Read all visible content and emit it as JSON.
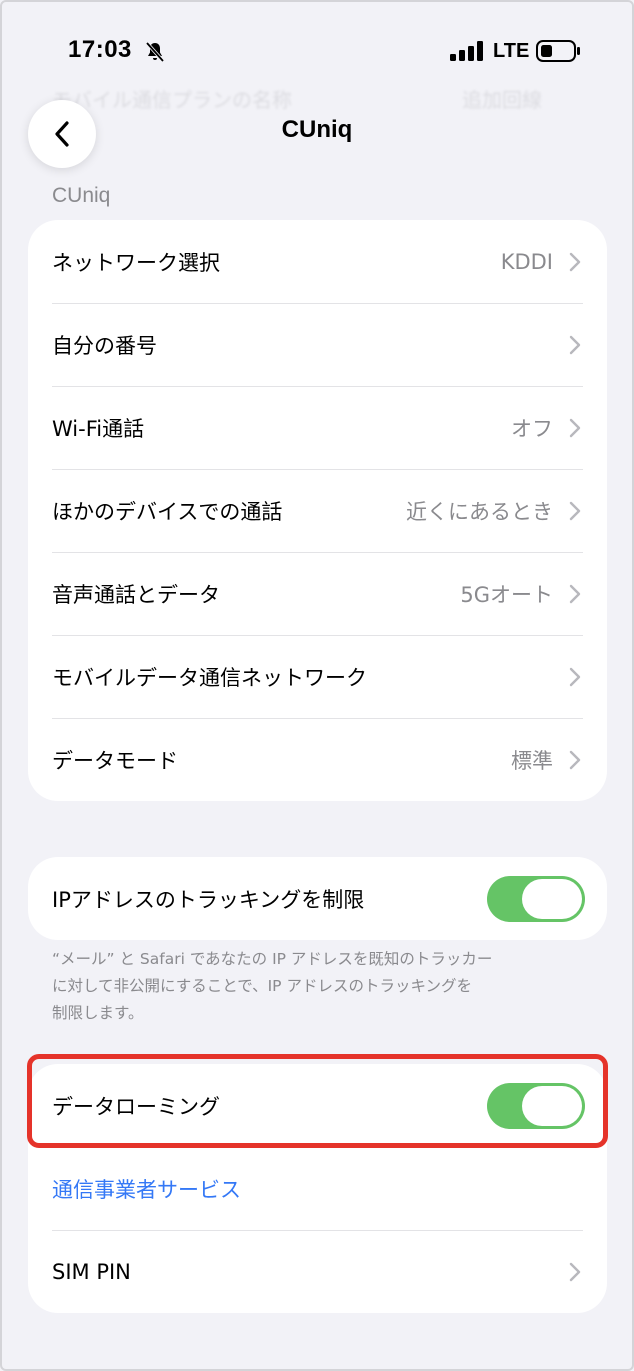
{
  "status_bar": {
    "time": "17:03",
    "network": "LTE",
    "icons": [
      "bell-slash-icon",
      "signal-bars-icon",
      "battery-icon"
    ]
  },
  "faded_header": {
    "label": "モバイル通信プランの名称",
    "value": "追加回線"
  },
  "nav": {
    "back_icon": "chevron-left-icon",
    "title": "CUniq"
  },
  "section_header": "CUniq",
  "settings_rows": [
    {
      "label": "ネットワーク選択",
      "value": "KDDI"
    },
    {
      "label": "自分の番号",
      "value": ""
    },
    {
      "label": "Wi-Fi通話",
      "value": "オフ"
    },
    {
      "label": "ほかのデバイスでの通話",
      "value": "近くにあるとき"
    },
    {
      "label": "音声通話とデータ",
      "value": "5Gオート"
    },
    {
      "label": "モバイルデータ通信ネットワーク",
      "value": ""
    },
    {
      "label": "データモード",
      "value": "標準"
    }
  ],
  "ip_tracking": {
    "label": "IPアドレスのトラッキングを制限",
    "enabled": true,
    "footnote_lines": [
      "“メール” と Safari であなたの IP アドレスを既知のトラッカー",
      "に対して非公開にすることで、IP アドレスのトラッキングを",
      "制限します。"
    ]
  },
  "roaming_card": {
    "data_roaming_label": "データローミング",
    "data_roaming_enabled": true,
    "carrier_services_label": "通信事業者サービス",
    "sim_pin_label": "SIM PIN"
  },
  "colors": {
    "background": "#f2f2f7",
    "toggle_on": "#65c466",
    "link": "#3478f6",
    "highlight": "#e5332a",
    "secondary_text": "#8a8a8e"
  }
}
